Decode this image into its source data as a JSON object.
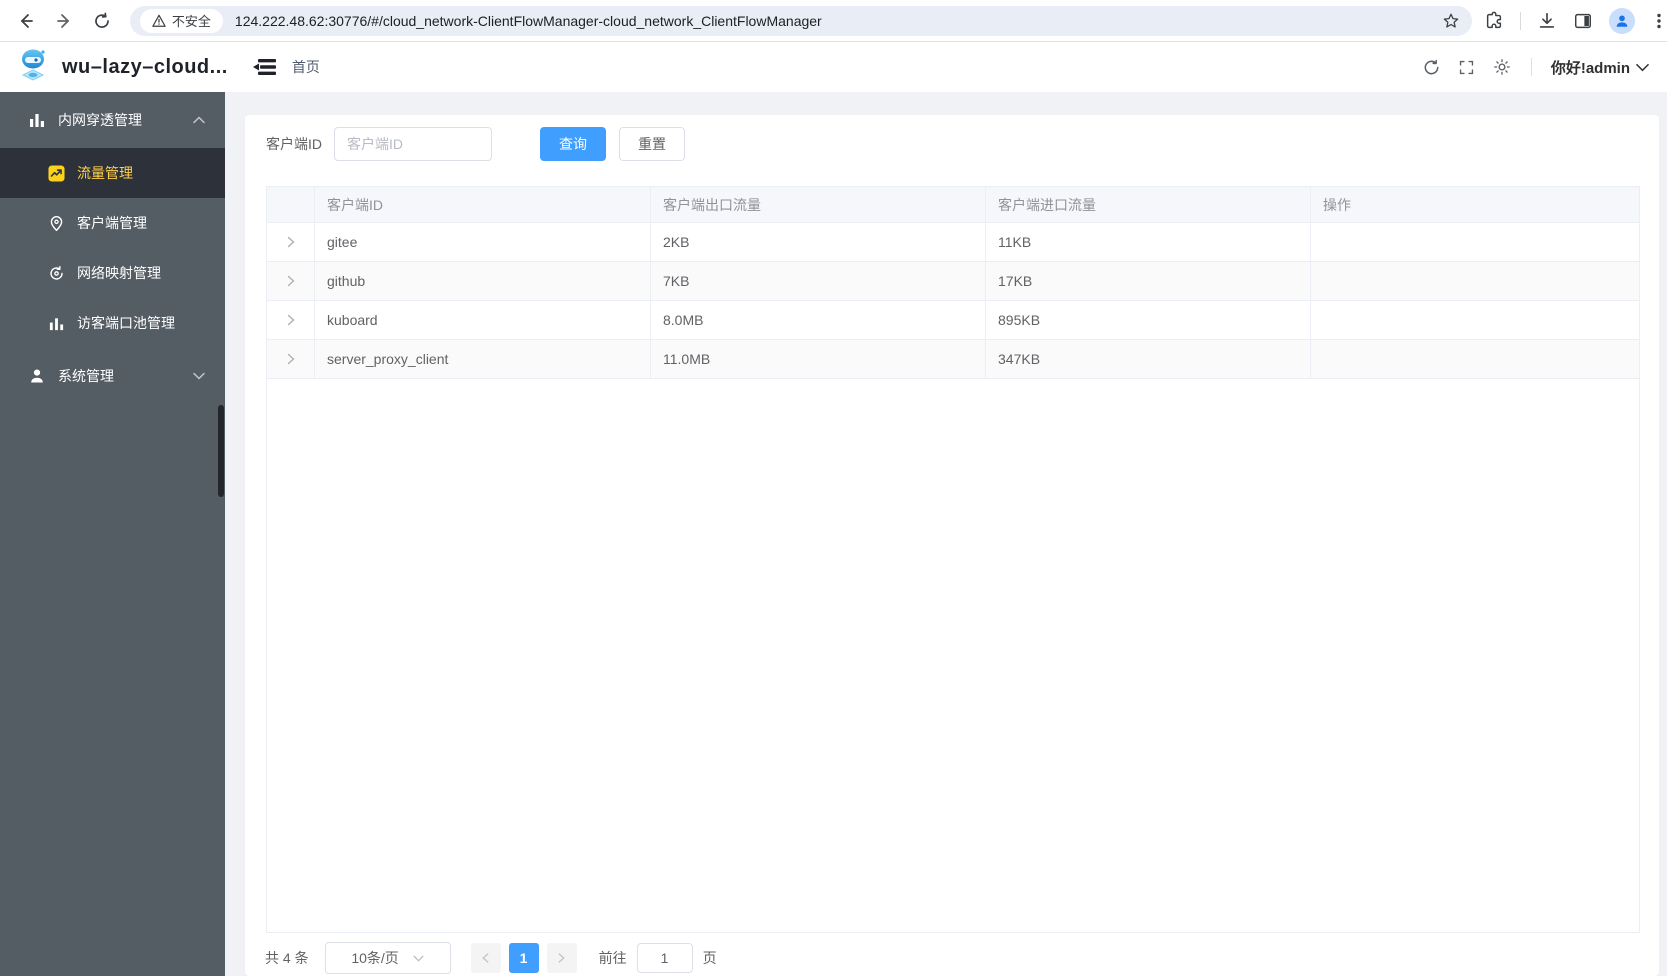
{
  "browser": {
    "security_chip": "不安全",
    "url": "124.222.48.62:30776/#/cloud_network-ClientFlowManager-cloud_network_ClientFlowManager"
  },
  "header": {
    "app_title": "wu–lazy–cloud...",
    "breadcrumb": "首页",
    "greeting": "你好!admin"
  },
  "sidebar": {
    "groups": [
      {
        "label": "内网穿透管理",
        "items": [
          {
            "label": "流量管理"
          },
          {
            "label": "客户端管理"
          },
          {
            "label": "网络映射管理"
          },
          {
            "label": "访客端口池管理"
          }
        ]
      },
      {
        "label": "系统管理"
      }
    ]
  },
  "filter": {
    "label": "客户端ID",
    "placeholder": "客户端ID",
    "search_label": "查询",
    "reset_label": "重置"
  },
  "table": {
    "columns": [
      "",
      "客户端ID",
      "客户端出口流量",
      "客户端进口流量",
      "操作"
    ],
    "rows": [
      {
        "id": "gitee",
        "out": "2KB",
        "in": "11KB"
      },
      {
        "id": "github",
        "out": "7KB",
        "in": "17KB"
      },
      {
        "id": "kuboard",
        "out": "8.0MB",
        "in": "895KB"
      },
      {
        "id": "server_proxy_client",
        "out": "11.0MB",
        "in": "347KB"
      }
    ]
  },
  "pagination": {
    "total": "共 4 条",
    "page_size": "10条/页",
    "current_page": "1",
    "goto_label": "前往",
    "goto_value": "1",
    "goto_unit": "页"
  },
  "colors": {
    "accent": "#409eff",
    "sidebar_bg": "#545c64",
    "sidebar_active_text": "#ffd04b",
    "active_icon_yellow": "#fcd21c",
    "table_header_bg": "#f5f7fa"
  }
}
